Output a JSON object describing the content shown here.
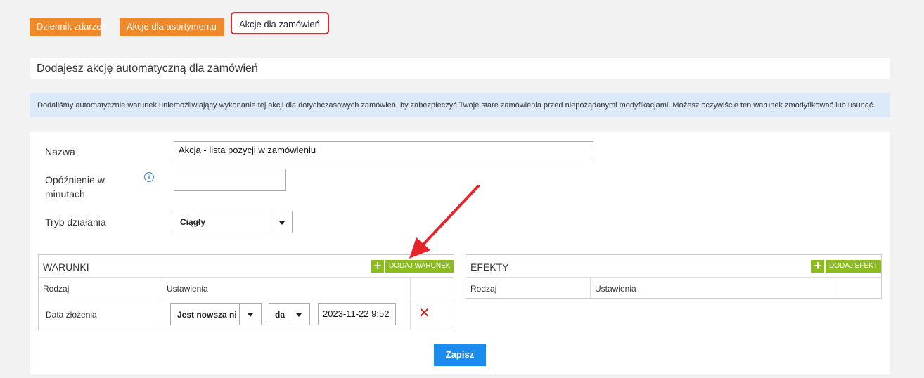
{
  "tabs": [
    {
      "label": "Dziennik zdarzeń"
    },
    {
      "label": "Akcje dla asortymentu"
    },
    {
      "label": "Akcje dla zamówień"
    }
  ],
  "header": {
    "title": "Dodajesz akcję automatyczną dla zamówień"
  },
  "info": {
    "text": "Dodaliśmy automatycznie warunek uniemożliwiający wykonanie tej akcji dla dotychczasowych zamówień, by zabezpieczyć Twoje stare zamówienia przed niepożądanymi modyfikacjami. Możesz oczywiście ten warunek zmodyfikować lub usunąć."
  },
  "form": {
    "name_label": "Nazwa",
    "name_value": "Akcja - lista pozycji w zamówieniu",
    "delay_label_1": "Opóźnienie w",
    "delay_label_2": "minutach",
    "delay_value": "",
    "mode_label": "Tryb działania",
    "mode_value": "Ciągły"
  },
  "conditions": {
    "title": "WARUNKI",
    "add_label": "DODAJ WARUNEK",
    "col_type": "Rodzaj",
    "col_settings": "Ustawienia",
    "rows": [
      {
        "type": "Data złożenia",
        "operator": "Jest nowsza ni",
        "unit": "da",
        "date": "2023-11-22 9:52"
      }
    ]
  },
  "effects": {
    "title": "EFEKTY",
    "add_label": "DODAJ EFEKT",
    "col_type": "Rodzaj",
    "col_settings": "Ustawienia"
  },
  "save_label": "Zapisz",
  "colors": {
    "tab": "#f0892a",
    "save": "#1a8cf0",
    "add": "#8cbd1c",
    "arrow": "#e5252b",
    "info_bg": "#dbe9f8"
  }
}
